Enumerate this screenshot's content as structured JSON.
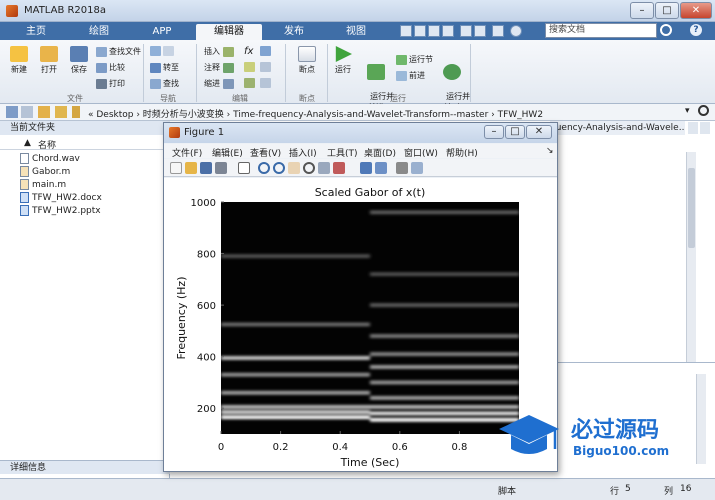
{
  "window": {
    "title": "MATLAB R2018a",
    "controls": [
      "–",
      "□",
      "✕"
    ]
  },
  "tabs": [
    {
      "label": "主页",
      "active": false
    },
    {
      "label": "绘图",
      "active": false
    },
    {
      "label": "APP",
      "active": false
    },
    {
      "label": "编辑器",
      "active": true
    },
    {
      "label": "发布",
      "active": false
    },
    {
      "label": "视图",
      "active": false
    }
  ],
  "search": {
    "placeholder": "搜索文档"
  },
  "ribbon": {
    "file": {
      "new": "新建",
      "open": "打开",
      "save": "保存",
      "find_files": "查找文件",
      "compare": "比较",
      "print": "打印",
      "group": "文件"
    },
    "navigate": {
      "goto": "转至",
      "find": "查找",
      "group": "导航"
    },
    "edit": {
      "insert": "插入",
      "comment": "注释",
      "indent": "缩进",
      "fx": "fx",
      "group": "编辑"
    },
    "breakpoints": {
      "label": "断点",
      "group": "断点"
    },
    "run": {
      "run": "运行",
      "run_advance": "运行并\n前进",
      "run_section": "运行节",
      "advance": "前进",
      "run_time": "运行并\n计时",
      "group": "运行"
    }
  },
  "path": {
    "text": "« Desktop › 时频分析与小波变换 › Time-frequency-Analysis-and-Wavelet-Transform--master › TFW_HW2"
  },
  "left_panel": {
    "title": "当前文件夹",
    "column": "名称",
    "sort_arrow": "▲",
    "files": [
      "Chord.wav",
      "Gabor.m",
      "main.m",
      "TFW_HW2.docx",
      "TFW_HW2.pptx"
    ],
    "details": "详细信息"
  },
  "editor_tab": "quency-Analysis-and-Wavele...",
  "status": {
    "script": "脚本",
    "row_label": "行",
    "row": "5",
    "col_label": "列",
    "col": "16"
  },
  "figure": {
    "title": "Figure 1",
    "menu": [
      "文件(F)",
      "编辑(E)",
      "查看(V)",
      "插入(I)",
      "工具(T)",
      "桌面(D)",
      "窗口(W)",
      "帮助(H)"
    ]
  },
  "chart_data": {
    "type": "heatmap",
    "title": "Scaled Gabor of x(t)",
    "xlabel": "Time (Sec)",
    "ylabel": "Frequency (Hz)",
    "xlim": [
      0,
      1
    ],
    "ylim": [
      100,
      1000
    ],
    "xticks": [
      "0",
      "0.2",
      "0.4",
      "0.6",
      "0.8"
    ],
    "yticks": [
      "200",
      "400",
      "600",
      "800",
      "1000"
    ],
    "colormap": "gray",
    "bands": [
      {
        "freq": 165,
        "t0": 0.0,
        "t1": 0.5,
        "intensity": 0.95
      },
      {
        "freq": 185,
        "t0": 0.0,
        "t1": 0.5,
        "intensity": 0.8
      },
      {
        "freq": 205,
        "t0": 0.0,
        "t1": 1.0,
        "intensity": 0.7
      },
      {
        "freq": 260,
        "t0": 0.0,
        "t1": 0.5,
        "intensity": 0.6
      },
      {
        "freq": 330,
        "t0": 0.0,
        "t1": 0.5,
        "intensity": 0.55
      },
      {
        "freq": 395,
        "t0": 0.0,
        "t1": 0.5,
        "intensity": 0.75
      },
      {
        "freq": 525,
        "t0": 0.0,
        "t1": 0.5,
        "intensity": 0.4
      },
      {
        "freq": 790,
        "t0": 0.0,
        "t1": 0.5,
        "intensity": 0.3
      },
      {
        "freq": 155,
        "t0": 0.5,
        "t1": 1.0,
        "intensity": 0.95
      },
      {
        "freq": 180,
        "t0": 0.5,
        "t1": 1.0,
        "intensity": 0.85
      },
      {
        "freq": 240,
        "t0": 0.5,
        "t1": 1.0,
        "intensity": 0.6
      },
      {
        "freq": 300,
        "t0": 0.5,
        "t1": 1.0,
        "intensity": 0.55
      },
      {
        "freq": 360,
        "t0": 0.5,
        "t1": 1.0,
        "intensity": 0.6
      },
      {
        "freq": 410,
        "t0": 0.5,
        "t1": 1.0,
        "intensity": 0.5
      },
      {
        "freq": 480,
        "t0": 0.5,
        "t1": 1.0,
        "intensity": 0.45
      },
      {
        "freq": 600,
        "t0": 0.5,
        "t1": 1.0,
        "intensity": 0.35
      },
      {
        "freq": 720,
        "t0": 0.5,
        "t1": 1.0,
        "intensity": 0.3
      },
      {
        "freq": 960,
        "t0": 0.5,
        "t1": 1.0,
        "intensity": 0.35
      }
    ]
  },
  "watermark": {
    "cn": "必过源码",
    "url": "Biguo100.com"
  },
  "colors": {
    "accent": "#3f6ea7",
    "ribbon": "#e3e9f1",
    "watermark": "#1f6fd0"
  }
}
